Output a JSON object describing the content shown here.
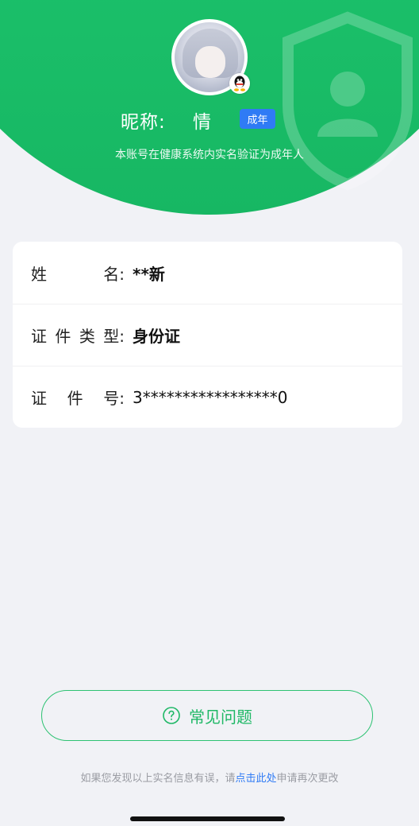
{
  "profile": {
    "nickname_label": "昵称:",
    "nickname_value": "情",
    "age_badge": "成年",
    "verify_text": "本账号在健康系统内实名验证为成年人"
  },
  "info": {
    "rows": [
      {
        "label_chars": [
          "姓",
          "名:"
        ],
        "value": "**新"
      },
      {
        "label_chars": [
          "证",
          "件",
          "类",
          "型:"
        ],
        "value": "身份证"
      },
      {
        "label_chars": [
          "证",
          "件",
          "号:"
        ],
        "value": "3*****************0"
      }
    ]
  },
  "faq": {
    "label": "常见问题",
    "icon": "question-circle-icon"
  },
  "footer": {
    "prefix": "如果您发现以上实名信息有误，请",
    "link": "点击此处",
    "suffix": "申请再次更改"
  },
  "colors": {
    "brand_green": "#1bc36a",
    "badge_blue": "#2f7bf5",
    "link_blue": "#2f7bf5",
    "background": "#f1f2f6"
  }
}
